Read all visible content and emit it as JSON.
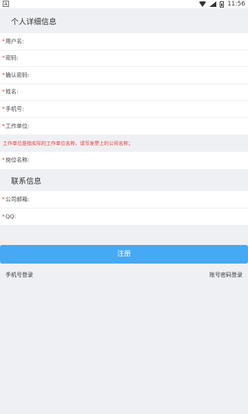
{
  "status_bar": {
    "app_glyph": "A",
    "time": "11:56"
  },
  "section_personal": {
    "title": "个人详细信息"
  },
  "personal_fields": [
    {
      "required": "*",
      "label": "用户名:"
    },
    {
      "required": "*",
      "label": "密码:"
    },
    {
      "required": "*",
      "label": "确认密码:"
    },
    {
      "required": "*",
      "label": "姓名:"
    },
    {
      "required": "*",
      "label": "手机号:"
    },
    {
      "required": "*",
      "label": "工作单位:"
    }
  ],
  "hint": "工作单位是指实际的工作单位名称，请写发票上的公司名称；",
  "position_field": {
    "required": "*",
    "label": "岗位名称:"
  },
  "section_contact": {
    "title": "联系信息"
  },
  "contact_fields": [
    {
      "required": "*",
      "label": "公司邮箱:"
    },
    {
      "required": "*",
      "label": "QQ:"
    }
  ],
  "register_button": "注册",
  "links": {
    "phone_login": "手机号登录",
    "account_login": "账号密码登录"
  }
}
